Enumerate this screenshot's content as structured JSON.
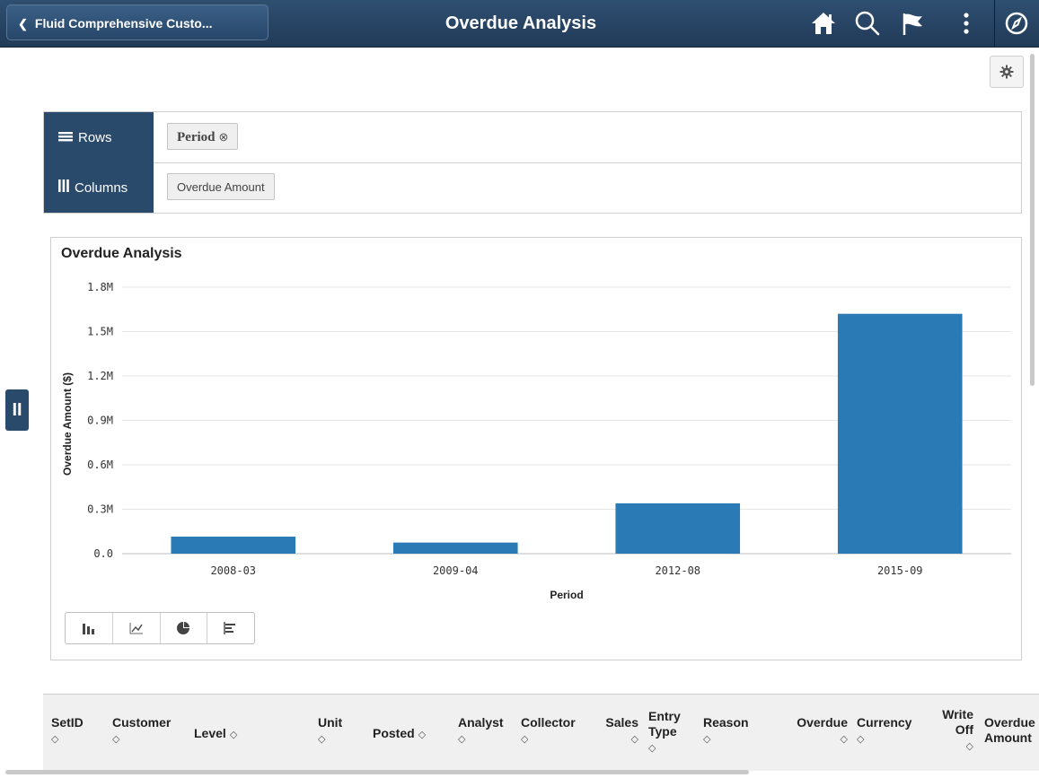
{
  "header": {
    "back_label": "Fluid Comprehensive Custo...",
    "title": "Overdue Analysis",
    "bg_color": "#24405f"
  },
  "icons": {
    "home": "home-icon",
    "search": "search-icon",
    "flag": "flag-icon",
    "more": "more-vertical-icon",
    "navigator": "compass-icon",
    "settings": "gear-icon"
  },
  "pivot": {
    "rows_label": "Rows",
    "columns_label": "Columns",
    "rows_chip": "Period",
    "columns_chip": "Overdue Amount"
  },
  "side_handle_label": "II",
  "chart_data": {
    "type": "bar",
    "title": "Overdue Analysis",
    "xlabel": "Period",
    "ylabel": "Overdue Amount ($)",
    "categories": [
      "2008-03",
      "2009-04",
      "2012-08",
      "2015-09"
    ],
    "values": [
      115000,
      75000,
      340000,
      1620000
    ],
    "ylim": [
      0,
      1800000
    ],
    "yticks": [
      "0.0",
      "0.3M",
      "0.6M",
      "0.9M",
      "1.2M",
      "1.5M",
      "1.8M"
    ],
    "grid": true,
    "bar_color": "#2a7ab5"
  },
  "chart_types": [
    {
      "name": "bar-chart-icon",
      "active": true
    },
    {
      "name": "line-chart-icon",
      "active": false
    },
    {
      "name": "pie-chart-icon",
      "active": false
    },
    {
      "name": "horizontal-bar-chart-icon",
      "active": false
    }
  ],
  "table": {
    "columns": [
      "SetID",
      "Customer",
      "Level",
      "Unit",
      "Posted",
      "Analyst",
      "Collector",
      "Sales",
      "Entry Type",
      "Reason",
      "Overdue",
      "Currency",
      "Write Off",
      "Overdue Amount"
    ],
    "sort_glyph": "◇"
  }
}
